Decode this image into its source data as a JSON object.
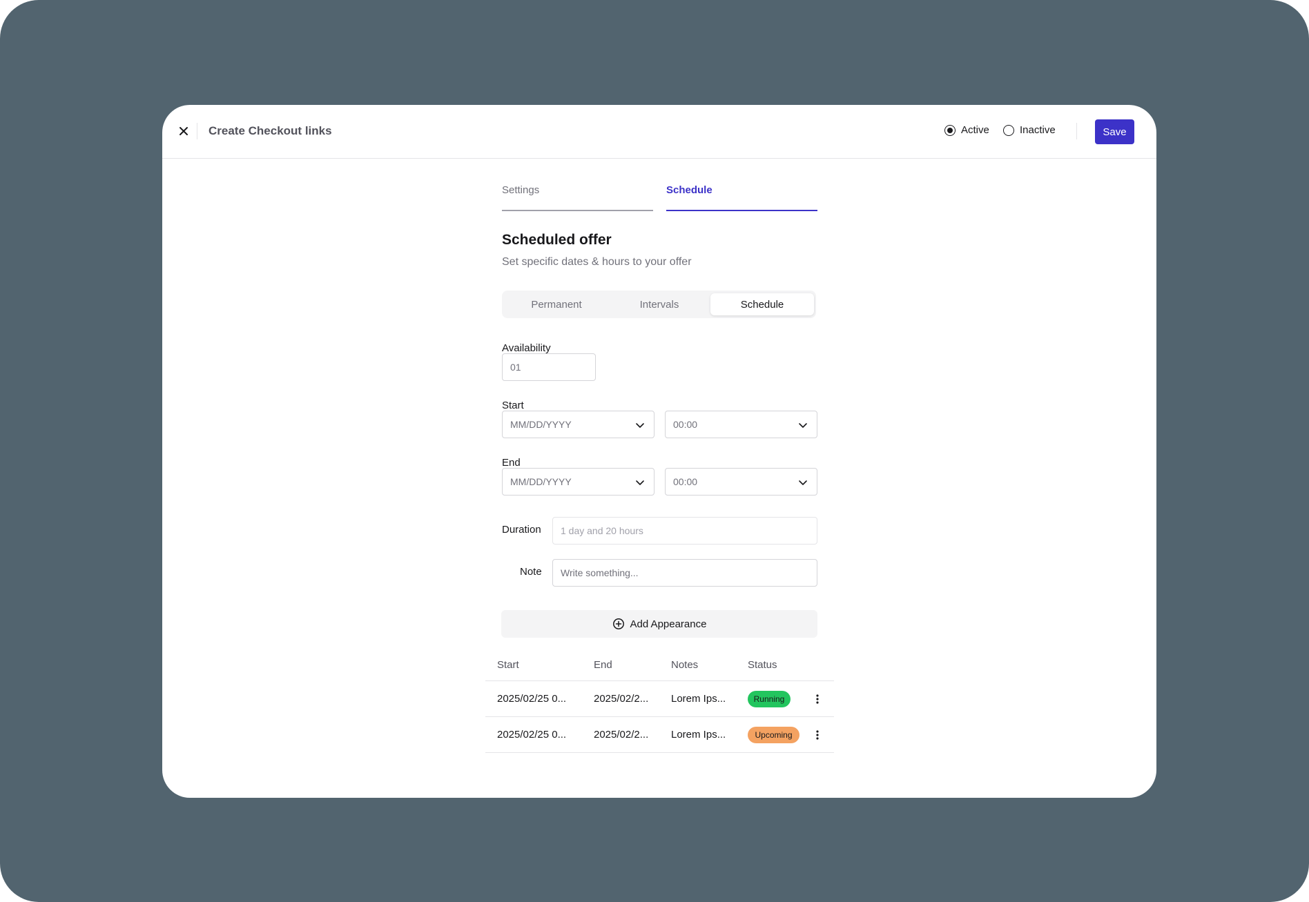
{
  "header": {
    "title": "Create Checkout links",
    "status_options": [
      {
        "label": "Active",
        "selected": true
      },
      {
        "label": "Inactive",
        "selected": false
      }
    ],
    "save_label": "Save"
  },
  "tabs": [
    {
      "label": "Settings",
      "active": false
    },
    {
      "label": "Schedule",
      "active": true
    }
  ],
  "section": {
    "title": "Scheduled offer",
    "subtitle": "Set specific dates & hours to your offer"
  },
  "mode_options": [
    {
      "label": "Permanent",
      "active": false
    },
    {
      "label": "Intervals",
      "active": false
    },
    {
      "label": "Schedule",
      "active": true
    }
  ],
  "form": {
    "availability_label": "Availability",
    "availability_value": "01",
    "start_label": "Start",
    "start_date_placeholder": "MM/DD/YYYY",
    "start_time_placeholder": "00:00",
    "end_label": "End",
    "end_date_placeholder": "MM/DD/YYYY",
    "end_time_placeholder": "00:00",
    "duration_label": "Duration",
    "duration_placeholder": "1 day and 20 hours",
    "note_label": "Note",
    "note_placeholder": "Write something..."
  },
  "add_button_label": "Add Appearance",
  "table": {
    "columns": [
      "Start",
      "End",
      "Notes",
      "Status"
    ],
    "rows": [
      {
        "start": "2025/02/25 0...",
        "end": "2025/02/2...",
        "notes": "Lorem Ips...",
        "status": "Running"
      },
      {
        "start": "2025/02/25 0...",
        "end": "2025/02/2...",
        "notes": "Lorem Ips...",
        "status": "Upcoming"
      }
    ]
  },
  "colors": {
    "backdrop": "#52646f",
    "accent": "#3c32c8",
    "running": "#22c55e",
    "upcoming": "#f4a261"
  },
  "icons": [
    "close-icon",
    "chevron-down-icon",
    "plus-circle-icon",
    "more-vertical-icon"
  ]
}
